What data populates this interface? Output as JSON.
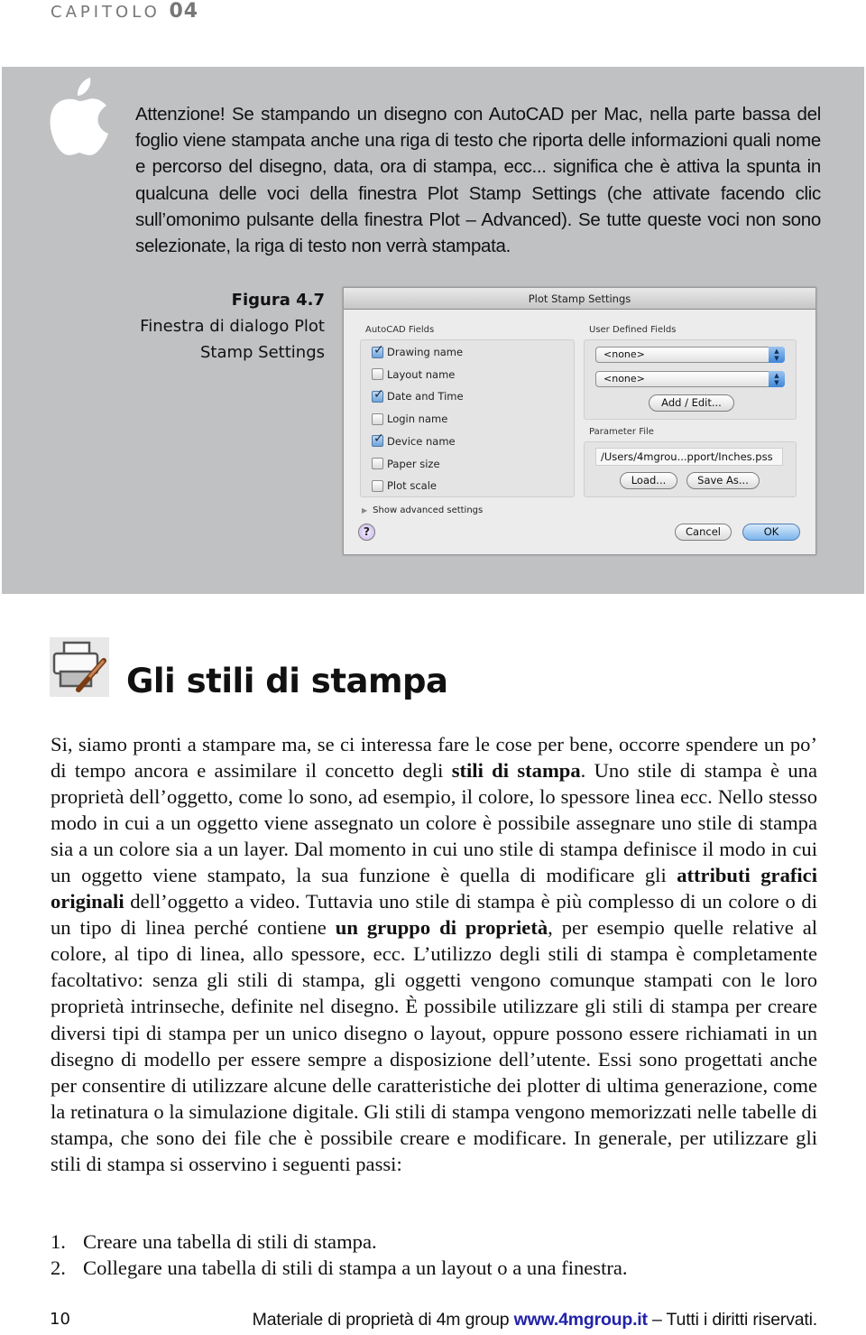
{
  "header": {
    "chapter_label": "CAPITOLO",
    "chapter_number": "04"
  },
  "note": {
    "icon": "apple-logo-icon",
    "text": "Attenzione! Se stampando un disegno con AutoCAD per Mac, nella parte bassa del foglio viene stampata anche una riga di testo che riporta delle informazioni quali nome e percorso del disegno, data, ora di stampa, ecc... significa che è attiva la spunta in qualcuna delle voci della finestra Plot Stamp Settings (che attivate facendo clic sull’omonimo pulsante della finestra Plot – Advanced). Se tutte queste voci non sono selezionate, la riga di testo non verrà stampata."
  },
  "figure": {
    "label": "Figura 4.7",
    "caption_line1": "Finestra di dialogo Plot",
    "caption_line2": "Stamp Settings"
  },
  "dialog": {
    "title": "Plot Stamp Settings",
    "autocad_fields_label": "AutoCAD Fields",
    "fields": [
      {
        "label": "Drawing name",
        "checked": true
      },
      {
        "label": "Layout name",
        "checked": false
      },
      {
        "label": "Date and Time",
        "checked": true
      },
      {
        "label": "Login name",
        "checked": false
      },
      {
        "label": "Device name",
        "checked": true
      },
      {
        "label": "Paper size",
        "checked": false
      },
      {
        "label": "Plot scale",
        "checked": false
      }
    ],
    "user_defined_label": "User Defined Fields",
    "user_field_1": "<none>",
    "user_field_2": "<none>",
    "add_edit_button": "Add / Edit...",
    "parameter_file_label": "Parameter File",
    "parameter_file_path": "/Users/4mgrou...pport/Inches.pss",
    "load_button": "Load...",
    "save_as_button": "Save As...",
    "advanced_toggle": "Show advanced settings",
    "help_button": "?",
    "cancel_button": "Cancel",
    "ok_button": "OK"
  },
  "section": {
    "icon": "printer-brush-icon",
    "title": "Gli stili di stampa",
    "body": [
      {
        "t": "Si, siamo pronti a stampare ma, se ci interessa fare le cose per bene, occorre spendere un po’ di tempo ancora e assimilare il concetto degli "
      },
      {
        "t": "stili di stampa",
        "b": true
      },
      {
        "t": ". Uno stile di stampa è una proprietà dell’oggetto, come lo sono, ad esempio, il colore, lo spessore linea ecc. Nello stesso modo in cui a un oggetto viene assegnato un colore è possibile assegnare uno stile di stampa sia a un colore sia a un layer. Dal momento in cui uno stile di stampa definisce il modo in cui un oggetto viene stampato, la sua funzione è quella di modificare gli "
      },
      {
        "t": "attributi grafici originali",
        "b": true
      },
      {
        "t": " dell’oggetto a video. Tuttavia uno stile di stampa è più complesso di un colore o di un tipo di linea perché contiene "
      },
      {
        "t": "un gruppo di proprietà",
        "b": true
      },
      {
        "t": ", per esempio quelle relative al colore, al tipo di linea, allo spessore, ecc. L’utilizzo degli stili di stampa è completamente facoltativo: senza gli stili di stampa, gli oggetti vengono comunque stampati con le loro proprietà intrinseche, definite nel disegno. È possibile utilizzare gli stili di stampa per creare diversi tipi di stampa per un unico disegno o layout, oppure possono essere richiamati in un disegno di modello per essere sempre a disposizione dell’utente. Essi sono progettati anche per consentire di utilizzare alcune delle caratteristiche dei plotter di ultima generazione, come la retinatura o la simulazione digitale. Gli stili di stampa vengono memorizzati nelle tabelle di stampa, che sono dei file che è possibile creare e modificare. In generale, per utilizzare gli stili di stampa si osservino i seguenti passi:"
      }
    ],
    "steps": [
      {
        "n": "1.",
        "text": "Creare una tabella di stili di stampa."
      },
      {
        "n": "2.",
        "text": "Collegare una tabella di stili di stampa a un layout o a una finestra."
      }
    ]
  },
  "footer": {
    "page_number": "10",
    "text_before": "Materiale di proprietà di 4m group ",
    "link": "www.4mgroup.it",
    "text_after": " – Tutti i diritti riservati.",
    "link_color": "#2222aa"
  }
}
